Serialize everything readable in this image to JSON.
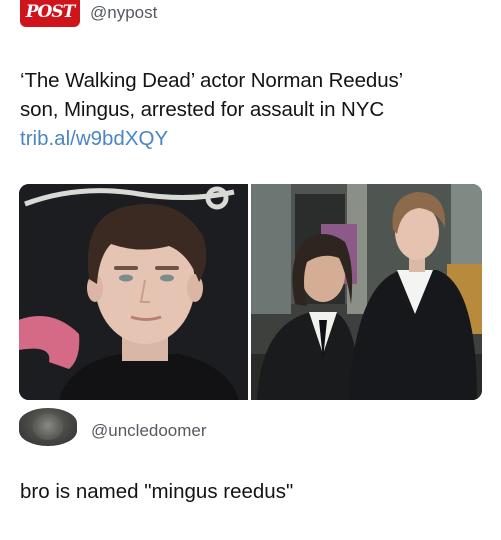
{
  "post": {
    "logo_text": "POST",
    "handle": "@nypost",
    "text_lines": [
      "‘The Walking Dead’ actor Norman Reedus’",
      "son, Mingus, arrested for assault in NYC"
    ],
    "link": "trib.al/w9bdXQY",
    "images": [
      {
        "alt": "headshot-photo"
      },
      {
        "alt": "red-carpet-photo"
      }
    ]
  },
  "reply": {
    "handle": "@uncledoomer",
    "text": "bro is named \"mingus reedus\""
  },
  "colors": {
    "brand_red": "#d0141c",
    "link_blue": "#4a86c7",
    "handle_gray": "#555a60",
    "text": "#141414"
  }
}
